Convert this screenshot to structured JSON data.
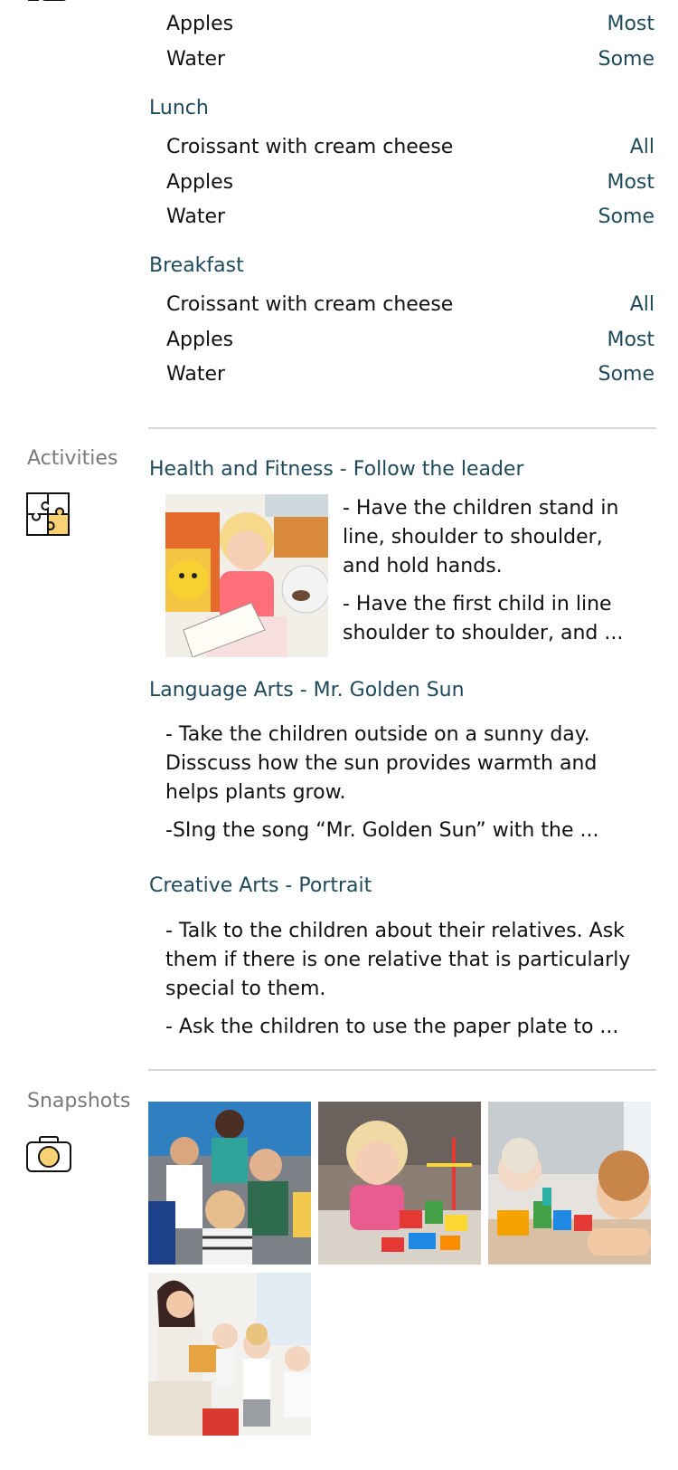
{
  "meals": {
    "top": {
      "items": [
        {
          "name": "Apples",
          "amount": "Most"
        },
        {
          "name": "Water",
          "amount": "Some"
        }
      ]
    },
    "lunch": {
      "label": "Lunch",
      "items": [
        {
          "name": "Croissant with cream cheese",
          "amount": "All"
        },
        {
          "name": "Apples",
          "amount": "Most"
        },
        {
          "name": "Water",
          "amount": "Some"
        }
      ]
    },
    "breakfast": {
      "label": "Breakfast",
      "items": [
        {
          "name": "Croissant with cream cheese",
          "amount": "All"
        },
        {
          "name": "Apples",
          "amount": "Most"
        },
        {
          "name": "Water",
          "amount": "Some"
        }
      ]
    }
  },
  "activities": {
    "label": "Activities",
    "icon": "puzzle-icon",
    "list": [
      {
        "title": "Health and Fitness - Follow the leader",
        "image": "child-reading-photo",
        "lines1": [
          "- Have the children stand in",
          "line, shoulder to shoulder,",
          "and hold hands."
        ],
        "lines2": [
          "- Have the first child in line",
          "shoulder to shoulder, and ..."
        ]
      },
      {
        "title": "Language Arts - Mr. Golden Sun",
        "lines1": [
          "- Take the children outside on a sunny day.",
          "Disscuss how the sun provides warmth and",
          "helps plants grow."
        ],
        "lines2": [
          "-SIng the song “Mr. Golden Sun” with the ..."
        ]
      },
      {
        "title": "Creative Arts - Portrait",
        "lines1": [
          "- Talk to the children about their relatives. Ask",
          "them if there is one relative that is particularly",
          "special to them."
        ],
        "lines2": [
          "- Ask the children to use the paper plate to ..."
        ]
      }
    ]
  },
  "snapshots": {
    "label": "Snapshots",
    "icon": "camera-icon",
    "photos": [
      "children-group-photo",
      "child-lego-photo",
      "children-playing-blocks-photo",
      "teacher-reading-photo"
    ]
  },
  "colors": {
    "accent": "#1f4a5c",
    "icon_yellow": "#f7d173",
    "divider": "#d6d6d6",
    "label_gray": "#7a7a7a"
  }
}
